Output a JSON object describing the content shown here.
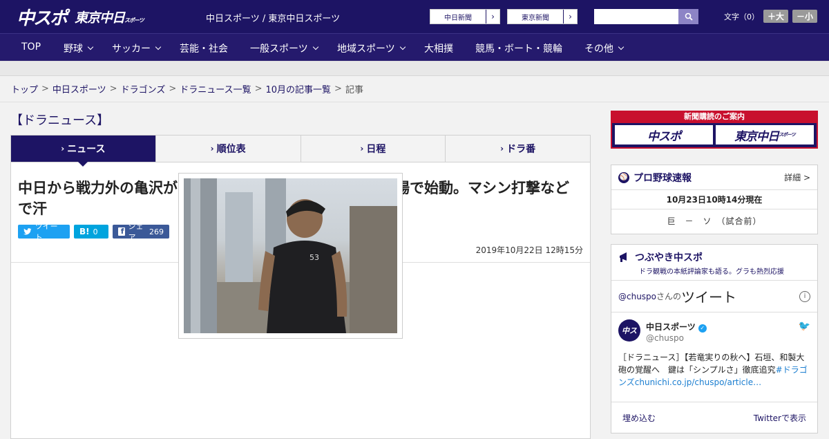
{
  "header": {
    "logo_main": "中スポ",
    "logo_tokyo": "東京中日",
    "logo_tokyo_small": "スポーツ",
    "site_links": "中日スポーツ / 東京中日スポーツ",
    "ext_links": [
      {
        "label": "中日新聞"
      },
      {
        "label": "東京新聞"
      }
    ],
    "search": {
      "placeholder": ""
    },
    "font_size": {
      "label": "文字（0）",
      "plus": "＋大",
      "minus": "－小"
    }
  },
  "nav": [
    {
      "label": "TOP",
      "dropdown": false
    },
    {
      "label": "野球",
      "dropdown": true
    },
    {
      "label": "サッカー",
      "dropdown": true
    },
    {
      "label": "芸能・社会",
      "dropdown": false
    },
    {
      "label": "一般スポーツ",
      "dropdown": true
    },
    {
      "label": "地域スポーツ",
      "dropdown": true
    },
    {
      "label": "大相撲",
      "dropdown": false
    },
    {
      "label": "競馬・ボート・競輪",
      "dropdown": false
    },
    {
      "label": "その他",
      "dropdown": true
    }
  ],
  "breadcrumb": [
    {
      "label": "トップ"
    },
    {
      "label": "中日スポーツ"
    },
    {
      "label": "ドラゴンズ"
    },
    {
      "label": "ドラニュース一覧"
    },
    {
      "label": "10月の記事一覧"
    },
    {
      "label": "記事"
    }
  ],
  "section_title": "【ドラニュース】",
  "tabs": [
    {
      "label": "ニュース",
      "active": true
    },
    {
      "label": "順位表",
      "active": false
    },
    {
      "label": "日程",
      "active": false
    },
    {
      "label": "ドラ番",
      "active": false
    }
  ],
  "article": {
    "headline": "中日から戦力外の亀沢がトライアウト受験表明　ナゴヤ球場で始動。マシン打撃などで汗",
    "share": {
      "tweet_label": "ツイート",
      "hatena_label": "B!",
      "hatena_count": "0",
      "facebook_label": "シェア",
      "facebook_count": "269"
    },
    "date": "2019年10月22日 12時15分"
  },
  "sidebar": {
    "subscribe": {
      "head": "新聞購読のご案内",
      "logo1": "中スポ",
      "logo2": "東京中日",
      "logo2_small": "スポーツ"
    },
    "baseball": {
      "title": "プロ野球速報",
      "more": "詳細 >",
      "time": "10月23日10時14分現在",
      "score": "巨　－　ソ　（試合前）"
    },
    "tsubuyaki": {
      "title": "つぶやき中スポ",
      "sub": "ドラ観戦の本紙評論家も語る。グラも熱烈応援"
    },
    "twitter": {
      "handle_prefix": "@chuspo",
      "handle_suffix": "さんの",
      "big_label": "ツイート",
      "name": "中日スポーツ",
      "handle": "@chuspo",
      "text": "［ドラニュース］【若竜実りの秋へ】石垣、和製大砲の覚醒へ　鍵は「シンプルさ」徹底追究",
      "tag_link": "#ドラゴンズ",
      "url_link": "chunichi.co.jp/chuspo/article…",
      "embed": "埋め込む",
      "view_on": "Twitterで表示"
    }
  },
  "colors": {
    "brand": "#1d1464",
    "nav": "#251a6d",
    "accent_red": "#c8102e",
    "twitter": "#1da1f2"
  }
}
